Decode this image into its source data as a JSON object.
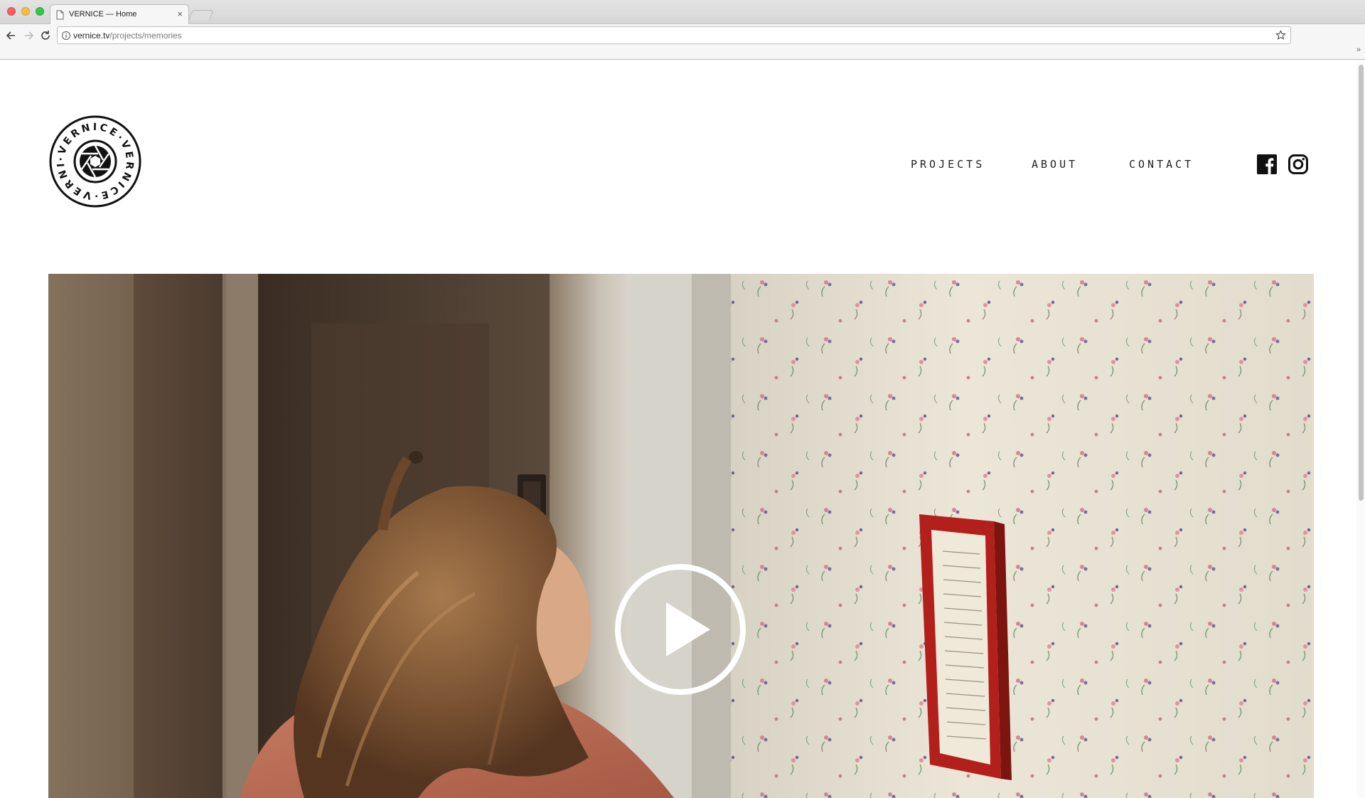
{
  "browser": {
    "tab_title": "VERNICE — Home",
    "tab_close": "×",
    "url_host": "vernice.tv",
    "url_path": "/projects/memories",
    "overflow": "»"
  },
  "site": {
    "logo_text": "·VERNICE·VERNICE·VERNICE",
    "nav": {
      "projects": "PROJECTS",
      "about": "ABOUT",
      "contact": "CONTACT"
    },
    "social": [
      "facebook-icon",
      "instagram-icon"
    ]
  },
  "hero": {
    "media": "video-thumbnail",
    "control": "play-icon"
  },
  "colors": {
    "text": "#222222",
    "wallpaper": "#e9e1d2",
    "frame_red": "#b3201c",
    "shirt": "#c0705a"
  }
}
